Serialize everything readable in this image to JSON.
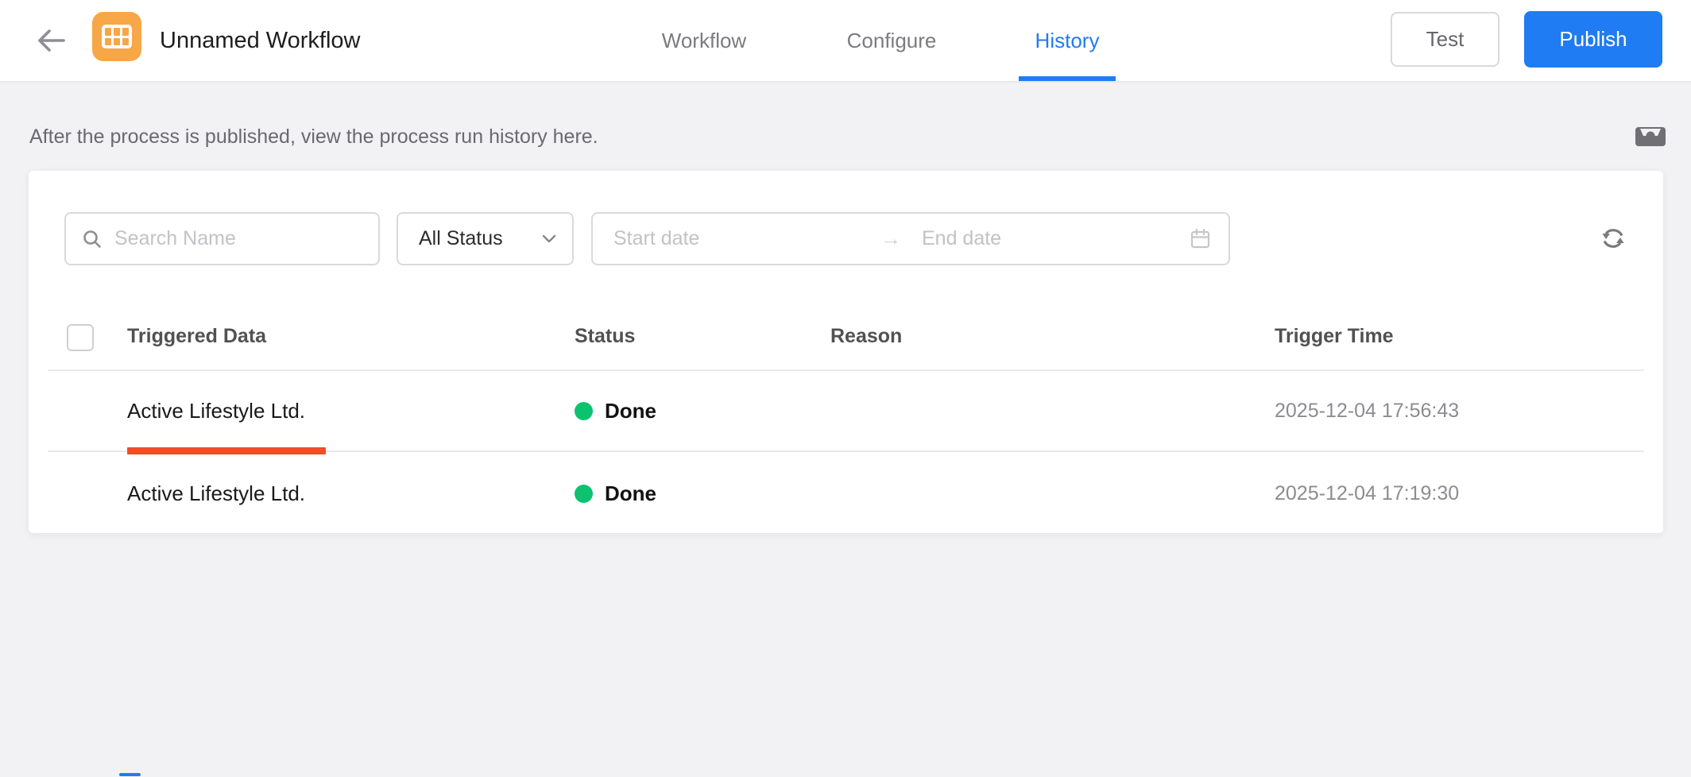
{
  "header": {
    "title": "Unnamed Workflow",
    "tabs": [
      {
        "label": "Workflow",
        "active": false
      },
      {
        "label": "Configure",
        "active": false
      },
      {
        "label": "History",
        "active": true
      }
    ],
    "test_label": "Test",
    "publish_label": "Publish"
  },
  "banner": {
    "text": "After the process is published, view the process run history here."
  },
  "filters": {
    "search_placeholder": "Search Name",
    "status_value": "All Status",
    "start_date_placeholder": "Start date",
    "end_date_placeholder": "End date",
    "range_separator": "→"
  },
  "table": {
    "columns": [
      "Triggered Data",
      "Status",
      "Reason",
      "Trigger Time"
    ],
    "rows": [
      {
        "triggered_data": "Active Lifestyle Ltd.",
        "status": "Done",
        "reason": "",
        "trigger_time": "2025-12-04 17:56:43"
      },
      {
        "triggered_data": "Active Lifestyle Ltd.",
        "status": "Done",
        "reason": "",
        "trigger_time": "2025-12-04 17:19:30"
      }
    ]
  },
  "icons": {
    "back": "arrow-left",
    "app": "table-grid",
    "inbox": "inbox-tray",
    "search": "magnifier",
    "status_dropdown": "chevron-down",
    "date_range": "calendar",
    "refresh": "sync-arrows"
  },
  "colors": {
    "accent_blue": "#1f7cf2",
    "brand_orange": "#f7a648",
    "status_green": "#0cc26e",
    "row_highlight_red": "#f04e23"
  }
}
